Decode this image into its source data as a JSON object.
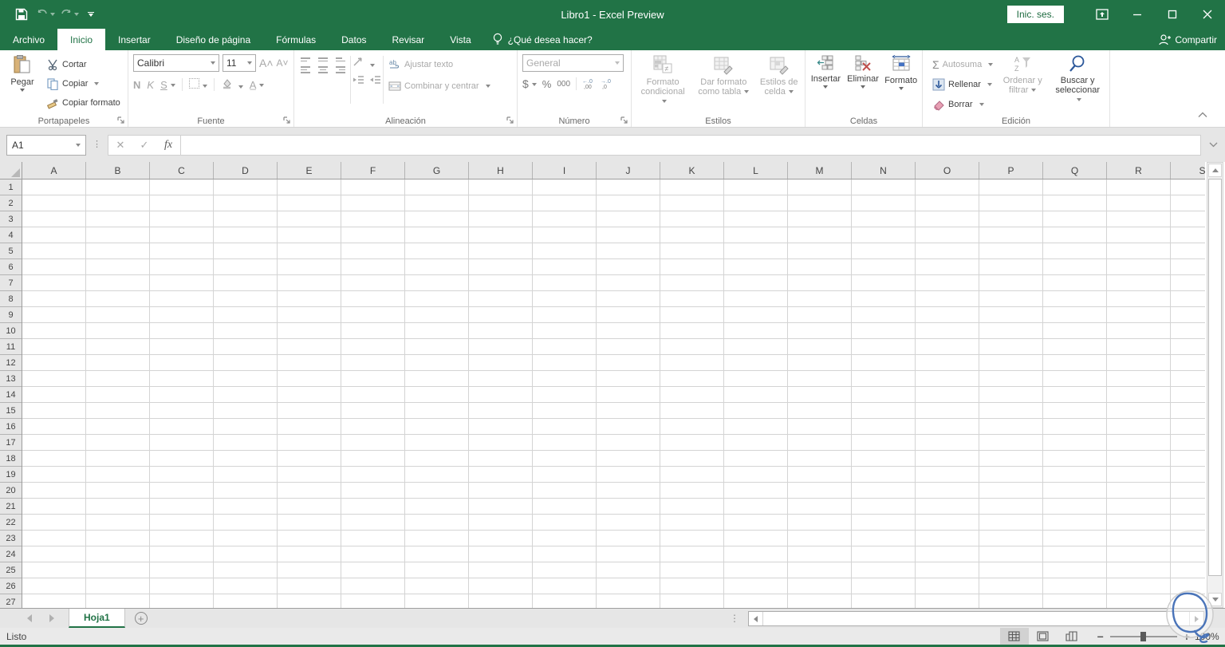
{
  "window": {
    "title": "Libro1  -  Excel Preview",
    "signin_label": "Inic. ses."
  },
  "qat": {
    "save": "save",
    "undo": "undo",
    "redo": "redo",
    "customize": "customize-quick-access"
  },
  "tabs": [
    {
      "id": "archivo",
      "label": "Archivo",
      "active": false
    },
    {
      "id": "inicio",
      "label": "Inicio",
      "active": true
    },
    {
      "id": "insertar",
      "label": "Insertar",
      "active": false
    },
    {
      "id": "diseno",
      "label": "Diseño de página",
      "active": false
    },
    {
      "id": "formulas",
      "label": "Fórmulas",
      "active": false
    },
    {
      "id": "datos",
      "label": "Datos",
      "active": false
    },
    {
      "id": "revisar",
      "label": "Revisar",
      "active": false
    },
    {
      "id": "vista",
      "label": "Vista",
      "active": false
    }
  ],
  "tellme": {
    "label": "¿Qué desea hacer?"
  },
  "share": {
    "label": "Compartir"
  },
  "ribbon": {
    "clipboard": {
      "title": "Portapapeles",
      "paste": "Pegar",
      "cut": "Cortar",
      "copy": "Copiar",
      "format_painter": "Copiar formato"
    },
    "font": {
      "title": "Fuente",
      "font_name": "Calibri",
      "font_size": "11",
      "bold": "N",
      "italic": "K",
      "underline": "S"
    },
    "alignment": {
      "title": "Alineación",
      "wrap": "Ajustar texto",
      "merge": "Combinar y centrar"
    },
    "number": {
      "title": "Número",
      "format": "General",
      "currency": "$",
      "percent": "%",
      "thousands": "000"
    },
    "styles": {
      "title": "Estilos",
      "conditional_1": "Formato",
      "conditional_2": "condicional",
      "table_1": "Dar formato",
      "table_2": "como tabla",
      "cellstyles_1": "Estilos de",
      "cellstyles_2": "celda"
    },
    "cells": {
      "title": "Celdas",
      "insert": "Insertar",
      "delete": "Eliminar",
      "format": "Formato"
    },
    "editing": {
      "title": "Edición",
      "autosum": "Autosuma",
      "fill": "Rellenar",
      "clear": "Borrar",
      "sort_1": "Ordenar y",
      "sort_2": "filtrar",
      "find_1": "Buscar y",
      "find_2": "seleccionar"
    }
  },
  "formula_bar": {
    "name_box": "A1",
    "fx": "fx"
  },
  "grid": {
    "columns": [
      "A",
      "B",
      "C",
      "D",
      "E",
      "F",
      "G",
      "H",
      "I",
      "J",
      "K",
      "L",
      "M",
      "N",
      "O",
      "P",
      "Q",
      "R",
      "S"
    ],
    "row_count": 27
  },
  "sheet_bar": {
    "tabs": [
      {
        "name": "Hoja1",
        "active": true
      }
    ]
  },
  "status_bar": {
    "status": "Listo",
    "zoom": "100%"
  },
  "colors": {
    "brand_green": "#217346",
    "ribbon_disabled": "#a9a9a9",
    "accent_blue": "#2b579a",
    "annotation_blue": "#4a74b9"
  }
}
